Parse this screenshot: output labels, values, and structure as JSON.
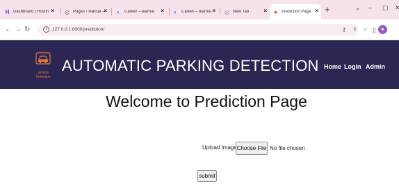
{
  "browser": {
    "tabs": [
      {
        "title": "Dashboard | Hostin",
        "favicon": "hostinger-icon",
        "icon_color": "#673de6"
      },
      {
        "title": "Pages ‹ learnai — V",
        "favicon": "wordpress-icon",
        "icon_color": "#555555"
      },
      {
        "title": "Career – learnai",
        "favicon": "site-icon",
        "icon_color": "#2f80ed"
      },
      {
        "title": "Career – learnai",
        "favicon": "site-icon",
        "icon_color": "#2f80ed"
      },
      {
        "title": "New Tab",
        "favicon": "new-tab-icon",
        "icon_color": "#888888"
      },
      {
        "title": "Prediction Page",
        "favicon": "location-pin-icon",
        "icon_color": "#e53935",
        "active": true
      }
    ],
    "url": "127.0.0.1:8000/prediction/"
  },
  "navbar": {
    "brand": "AUTOMATIC PARKING DETECTION",
    "logo_text": "Vehicle Detection",
    "links": [
      "Home",
      "Login",
      "Admin"
    ],
    "background": "#2b2752",
    "logo_color": "#e0783c"
  },
  "main": {
    "heading": "Welcome to Prediction Page",
    "upload_label": "Upload Image",
    "choose_file_label": "Choose File",
    "file_status": "No file chosen",
    "submit_label": "submit"
  }
}
